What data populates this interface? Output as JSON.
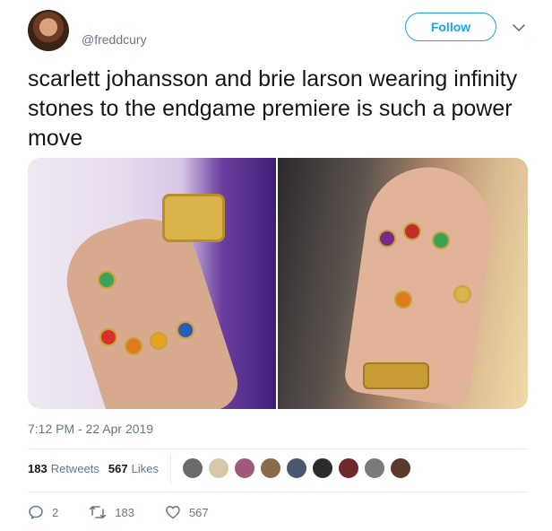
{
  "author": {
    "handle": "@freddcury"
  },
  "header": {
    "follow_label": "Follow"
  },
  "tweet": {
    "text": "scarlett johansson and brie larson wearing infinity stones to the endgame premiere is such a power move",
    "timestamp": "7:12 PM - 22 Apr 2019"
  },
  "stats": {
    "retweets_count": "183",
    "retweets_label": "Retweets",
    "likes_count": "567",
    "likes_label": "Likes"
  },
  "actions": {
    "replies": "2",
    "retweets": "183",
    "likes": "567"
  },
  "colors": {
    "accent": "#1da1f2",
    "muted": "#657786",
    "text": "#14171a"
  },
  "icons": [
    "chevron-down-icon",
    "reply-icon",
    "retweet-icon",
    "heart-icon"
  ]
}
